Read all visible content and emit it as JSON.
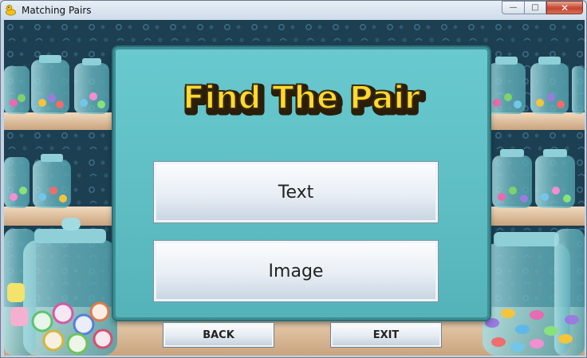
{
  "window": {
    "title": "Matching Pairs",
    "min_glyph": "—",
    "max_glyph": "□",
    "close_glyph": "✕"
  },
  "menu": {
    "heading": "Find The Pair",
    "text_button": "Text",
    "image_button": "Image",
    "back_button": "BACK",
    "exit_button": "EXIT"
  },
  "colors": {
    "panel": "#5fc1c7",
    "heading_fill": "#ffd92e",
    "heading_outline": "#3a2a10",
    "shelf": "#e6c8a6",
    "wallpaper": "#1c3e50"
  }
}
